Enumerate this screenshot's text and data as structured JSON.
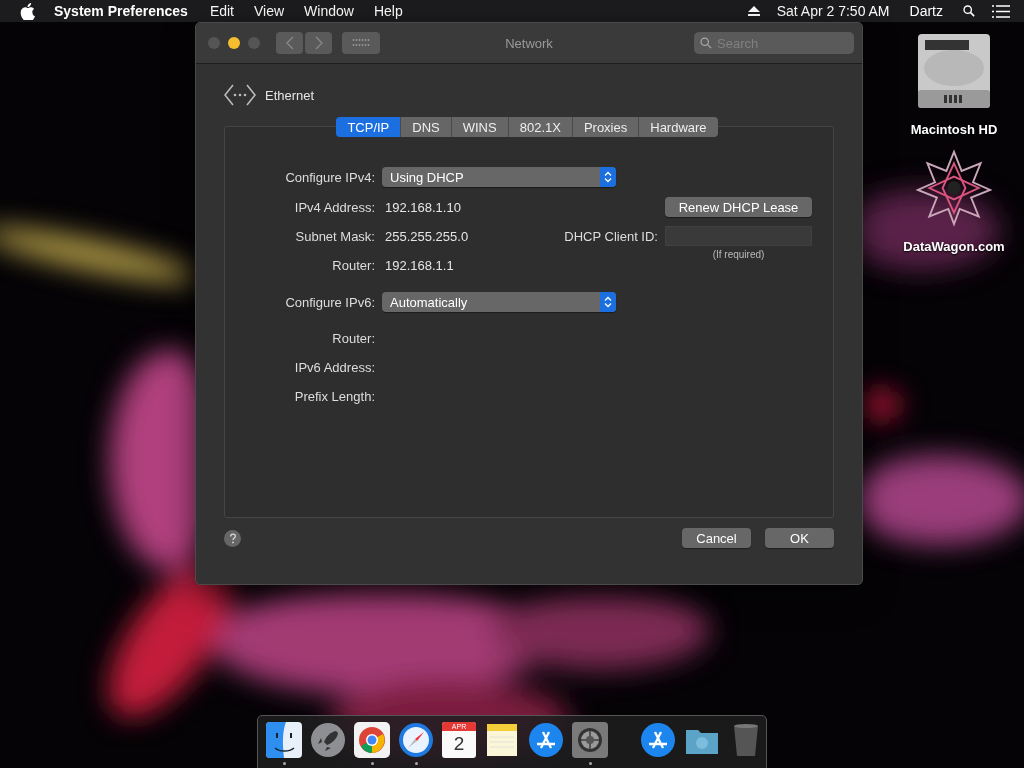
{
  "menu_bar": {
    "app_name": "System Preferences",
    "menus": [
      "Edit",
      "View",
      "Window",
      "Help"
    ],
    "clock": "Sat Apr 2  7:50 AM",
    "user": "Dartz"
  },
  "window": {
    "title": "Network",
    "search": {
      "placeholder": "Search"
    },
    "service": "Ethernet",
    "tabs": [
      {
        "label": "TCP/IP",
        "selected": true
      },
      {
        "label": "DNS",
        "selected": false
      },
      {
        "label": "WINS",
        "selected": false
      },
      {
        "label": "802.1X",
        "selected": false
      },
      {
        "label": "Proxies",
        "selected": false
      },
      {
        "label": "Hardware",
        "selected": false
      }
    ],
    "ipv4_fields": [
      {
        "kind": "select",
        "label": "Configure IPv4:",
        "value": "Using DHCP"
      },
      {
        "kind": "text",
        "label": "IPv4 Address:",
        "value": "192.168.1.10"
      },
      {
        "kind": "text",
        "label": "Subnet Mask:",
        "value": "255.255.255.0"
      },
      {
        "kind": "text",
        "label": "Router:",
        "value": "192.168.1.1"
      }
    ],
    "renew_button": "Renew DHCP Lease",
    "client_id": {
      "label": "DHCP Client ID:",
      "hint": "(If required)"
    },
    "ipv6_fields": [
      {
        "kind": "select",
        "label": "Configure IPv6:",
        "value": "Automatically"
      },
      {
        "kind": "text",
        "label": "Router:"
      },
      {
        "kind": "text",
        "label": "IPv6 Address:"
      },
      {
        "kind": "text",
        "label": "Prefix Length:"
      }
    ],
    "buttons": [
      "Cancel",
      "OK"
    ]
  },
  "desktop_icons": [
    {
      "kind": "drive",
      "label": "Macintosh HD"
    },
    {
      "kind": "star",
      "label": "DataWagon.com"
    }
  ],
  "dock": {
    "calendar": {
      "month": "APR",
      "day": "2"
    },
    "items": [
      {
        "kind": "finder",
        "running": true
      },
      {
        "kind": "rocket",
        "running": false
      },
      {
        "kind": "chrome",
        "running": true
      },
      {
        "kind": "compass",
        "running": true
      },
      {
        "kind": "calendar",
        "running": false
      },
      {
        "kind": "notes",
        "running": false
      },
      {
        "kind": "appstore",
        "running": false
      },
      {
        "kind": "gear",
        "running": true
      },
      {
        "kind": "separator"
      },
      {
        "kind": "appstore",
        "running": false
      },
      {
        "kind": "folder",
        "running": false
      },
      {
        "kind": "trash",
        "running": false
      }
    ]
  }
}
